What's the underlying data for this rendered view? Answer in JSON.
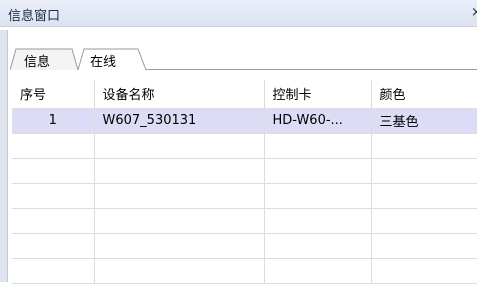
{
  "window": {
    "title": "信息窗口"
  },
  "tabs": [
    {
      "label": "信息",
      "active": false
    },
    {
      "label": "在线",
      "active": true
    }
  ],
  "table": {
    "columns": [
      "序号",
      "设备名称",
      "控制卡",
      "颜色"
    ],
    "rows": [
      [
        "1",
        "W607_530131",
        "HD-W60-...",
        "三基色"
      ],
      [
        "",
        "",
        "",
        ""
      ],
      [
        "",
        "",
        "",
        ""
      ],
      [
        "",
        "",
        "",
        ""
      ],
      [
        "",
        "",
        "",
        ""
      ],
      [
        "",
        "",
        "",
        ""
      ],
      [
        "",
        "",
        "",
        ""
      ]
    ]
  },
  "colors": {
    "selected_row": "#dcdcf6",
    "title_bar": "#dbe3f2",
    "grid_line": "#dcdcdc"
  }
}
